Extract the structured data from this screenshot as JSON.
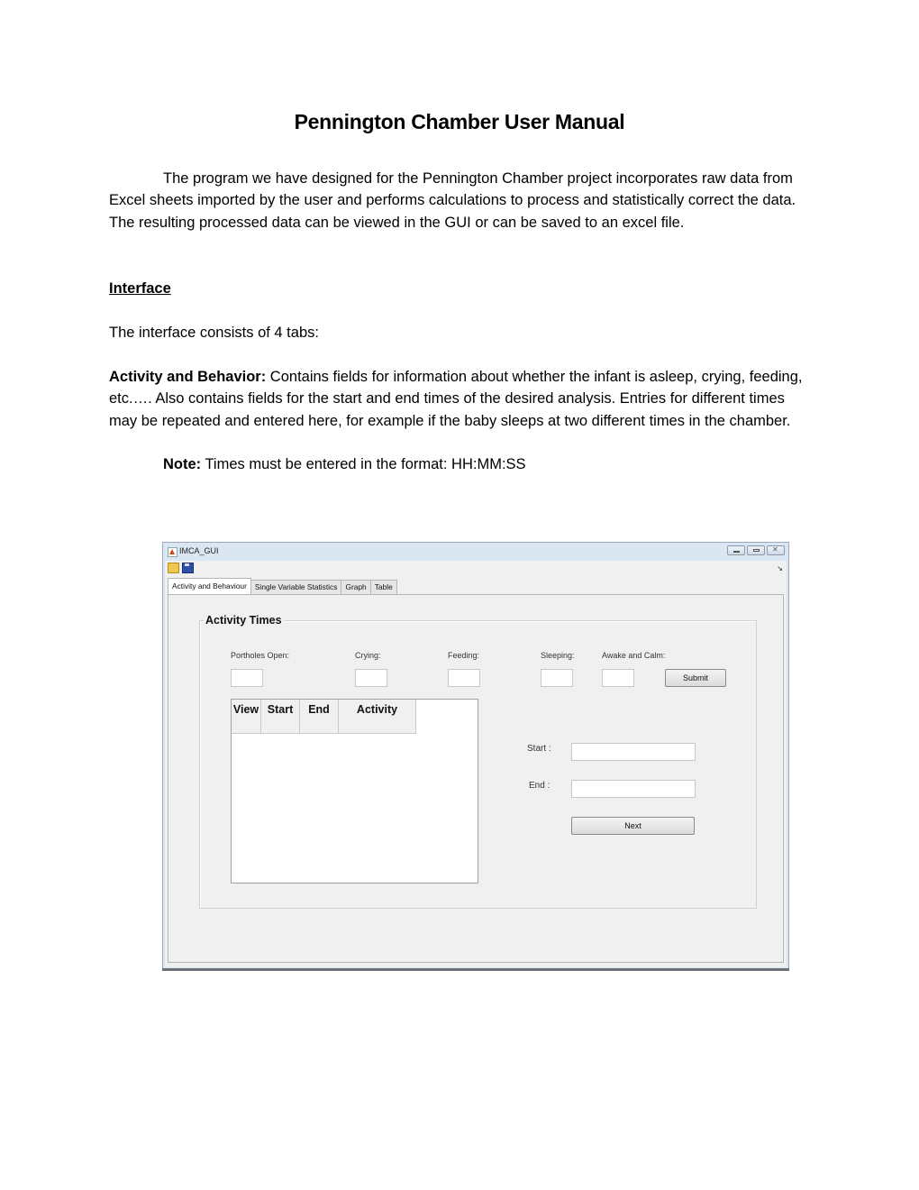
{
  "document": {
    "title": "Pennington Chamber User Manual",
    "intro": "The program we have designed for the Pennington Chamber project incorporates raw data from Excel sheets imported by the user and performs calculations to process and statistically correct the data.  The resulting processed data can be viewed in the GUI or can be saved to an excel file.",
    "section_heading": "Interface ",
    "tabs_intro": "The interface consists of 4 tabs:",
    "activity_term": "Activity and Behavior:",
    "activity_desc": " Contains fields for information about whether the infant is asleep, crying, feeding, etc.…. Also contains fields for the start and end times of the desired analysis. Entries for different times may be repeated and entered here, for example if the baby sleeps at two different times in the chamber.",
    "note_term": "Note:",
    "note_text": " Times must be entered in the format: HH:MM:SS"
  },
  "window": {
    "title": "IMCA_GUI",
    "toolbar": {
      "open_icon": "folder-open-icon",
      "save_icon": "save-icon",
      "toggle_icon": "↘"
    },
    "controls": {
      "minimize": "minimize-icon",
      "maximize": "maximize-icon",
      "close": "close-icon",
      "close_glyph": "✕"
    },
    "tabs": [
      {
        "label": "Activity and Behaviour",
        "active": true
      },
      {
        "label": "Single Variable Statistics",
        "active": false
      },
      {
        "label": "Graph",
        "active": false
      },
      {
        "label": "Table",
        "active": false
      }
    ],
    "panel": {
      "group_title": "Activity Times",
      "fields": [
        {
          "label": "Portholes Open:",
          "value": ""
        },
        {
          "label": "Crying:",
          "value": ""
        },
        {
          "label": "Feeding:",
          "value": ""
        },
        {
          "label": "Sleeping:",
          "value": ""
        },
        {
          "label": "Awake and Calm:",
          "value": ""
        }
      ],
      "submit_label": "Submit",
      "table": {
        "columns": [
          "View",
          "Start",
          "End",
          "Activity"
        ],
        "rows": []
      },
      "start_label": "Start :",
      "start_value": "",
      "end_label": "End :",
      "end_value": "",
      "next_label": "Next"
    }
  }
}
